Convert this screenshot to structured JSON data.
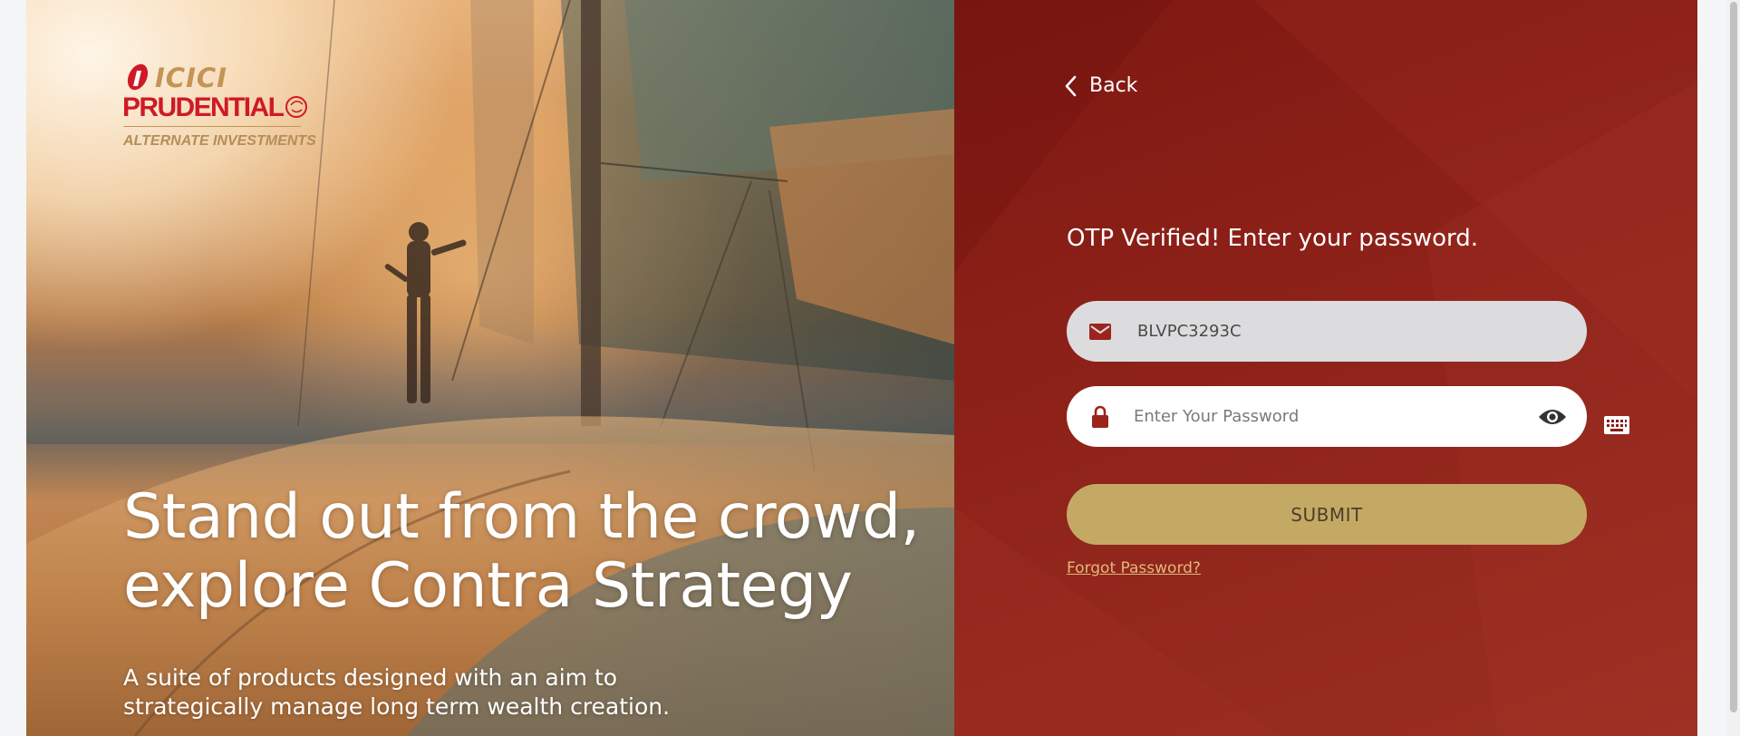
{
  "brand": {
    "logo_line1": "ICICI",
    "logo_line2": "PRUDENTIAL",
    "logo_tagline": "ALTERNATE INVESTMENTS"
  },
  "hero": {
    "title": "Stand out from the crowd,\nexplore Contra Strategy",
    "subtitle": "A suite of products designed with an aim to\nstrategically manage long term wealth creation."
  },
  "login": {
    "back_label": "Back",
    "heading": "OTP Verified! Enter your password.",
    "user_value": "BLVPC3293C",
    "password_placeholder": "Enter Your Password",
    "submit_label": "SUBMIT",
    "forgot_label": "Forgot Password?"
  },
  "colors": {
    "panel_red": "#8a1e17",
    "submit_gold": "#c4a964",
    "link_gold": "#e0b97a",
    "logo_red": "#cf1a26",
    "logo_gold": "#c49454"
  },
  "icons": {
    "back": "chevron-left-icon",
    "user_field": "mail-icon",
    "password_field": "lock-icon",
    "toggle_password": "eye-icon",
    "virtual_keyboard": "keyboard-icon"
  }
}
